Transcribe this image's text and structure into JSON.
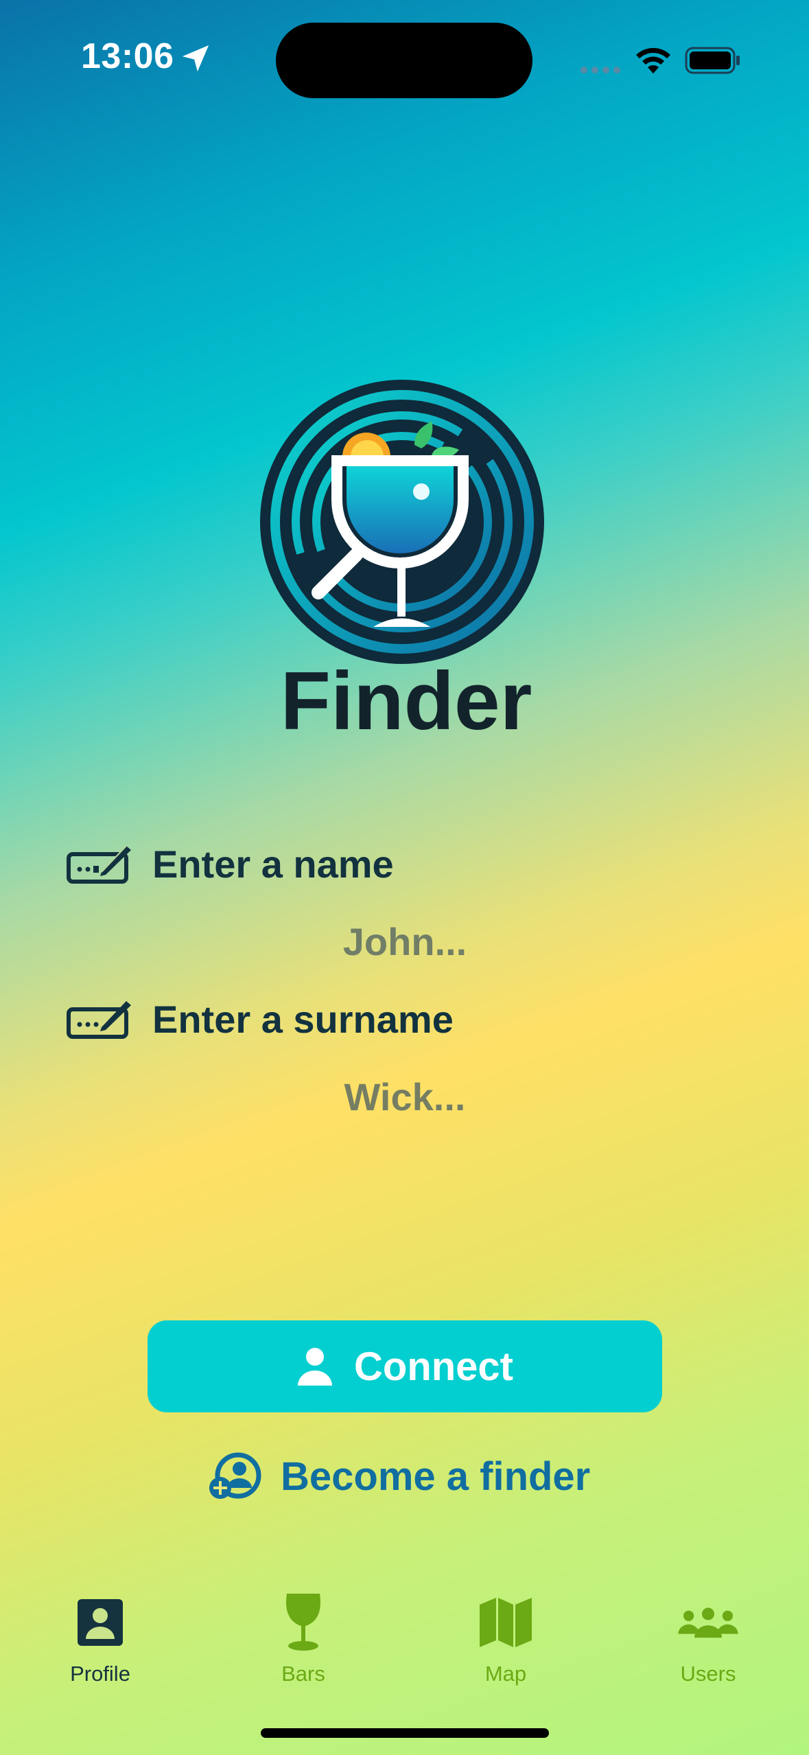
{
  "status_bar": {
    "time": "13:06"
  },
  "brand": {
    "name": "Finder"
  },
  "form": {
    "name_label": "Enter a name",
    "name_placeholder": "John...",
    "surname_label": "Enter a surname",
    "surname_placeholder": "Wick..."
  },
  "actions": {
    "connect_label": "Connect",
    "become_finder_label": "Become a finder"
  },
  "tab_bar": {
    "items": [
      {
        "label": "Profile",
        "icon": "person-card-icon",
        "active": true
      },
      {
        "label": "Bars",
        "icon": "wine-glass-icon",
        "active": false
      },
      {
        "label": "Map",
        "icon": "map-icon",
        "active": false
      },
      {
        "label": "Users",
        "icon": "people-icon",
        "active": false
      }
    ]
  },
  "colors": {
    "accent": "#03cfd0",
    "link": "#116ea0",
    "tab_inactive": "#6ba915",
    "tab_active": "#15323f",
    "text_dark": "#12323f"
  }
}
